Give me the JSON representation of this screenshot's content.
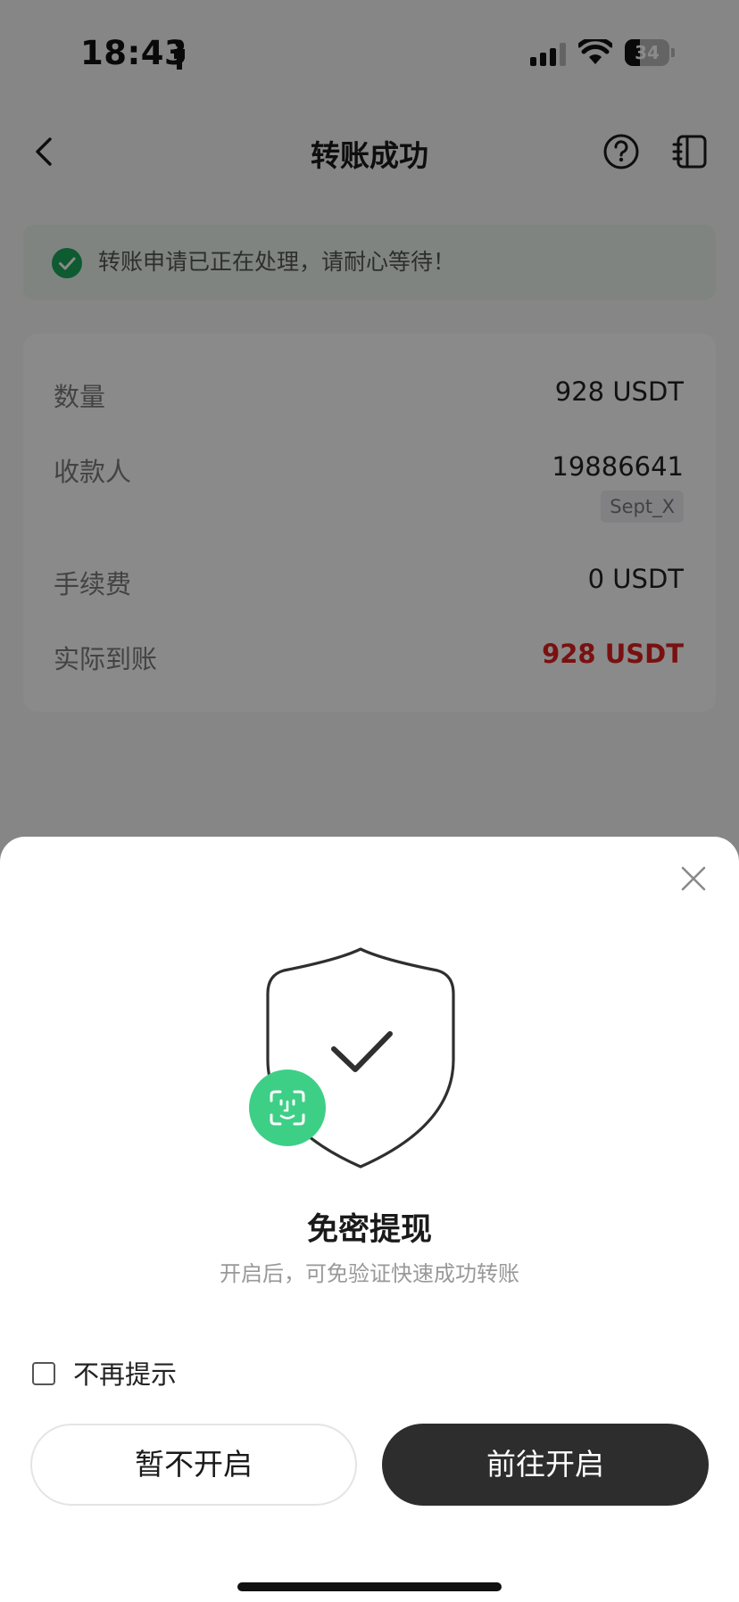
{
  "status_bar": {
    "time": "18:43",
    "battery_level": "34",
    "battery_fraction": 0.34,
    "icons": [
      "person-icon",
      "signal-icon",
      "wifi-icon",
      "battery-icon"
    ]
  },
  "nav": {
    "title": "转账成功",
    "icons": [
      "chevron-left-icon",
      "help-icon",
      "records-icon"
    ]
  },
  "notice": {
    "text": "转账申请已正在处理，请耐心等待！",
    "icon": "check-circle-icon",
    "color": "#1aa65c"
  },
  "details": {
    "rows": [
      {
        "label": "数量",
        "value": "928 USDT"
      },
      {
        "label": "收款人",
        "value": "19886641",
        "tag": "Sept_X"
      },
      {
        "label": "手续费",
        "value": "0 USDT"
      },
      {
        "label": "实际到账",
        "value": "928 USDT"
      }
    ],
    "highlight_color": "#e02020"
  },
  "sheet": {
    "title": "免密提现",
    "description": "开启后，可免验证快速成功转账",
    "checkbox_label": "不再提示",
    "checkbox_checked": false,
    "secondary_button": "暂不开启",
    "primary_button": "前往开启",
    "icons": [
      "close-icon",
      "shield-check-icon",
      "face-id-icon"
    ],
    "accent_color": "#3ecf86",
    "primary_color": "#2d2d2d"
  }
}
